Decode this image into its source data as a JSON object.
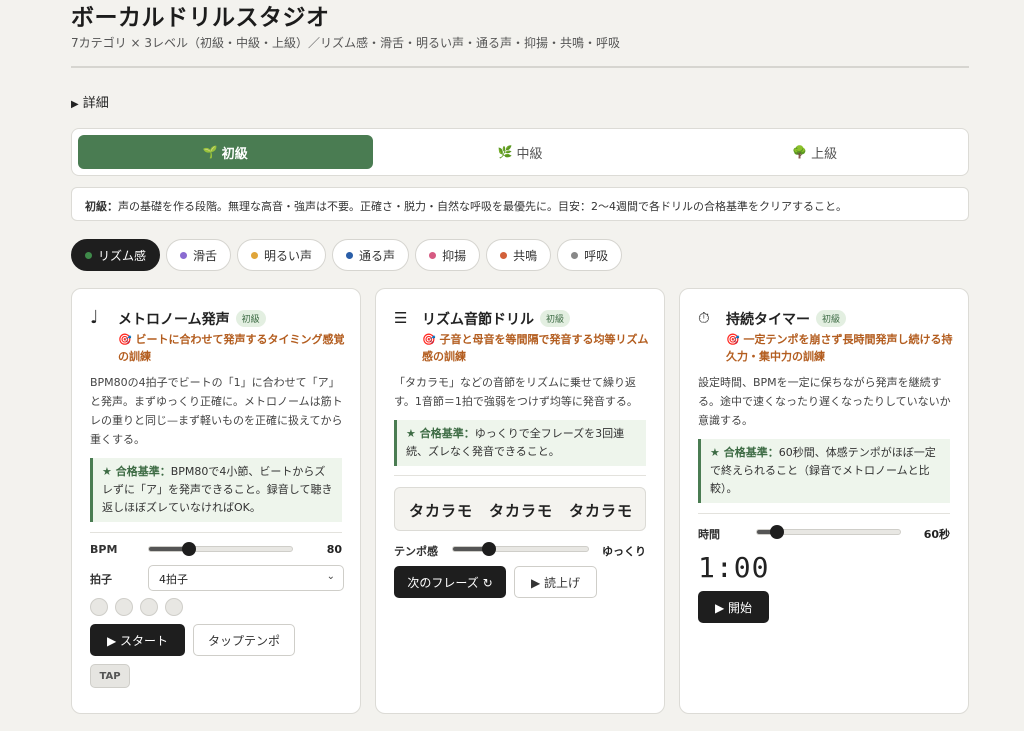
{
  "app": {
    "title": "ボーカルドリルスタジオ",
    "subtitle": "7カテゴリ × 3レベル（初級・中級・上級）／リズム感・滑舌・明るい声・通る声・抑揚・共鳴・呼吸",
    "details_label": "詳細"
  },
  "levels": [
    {
      "icon": "🌱",
      "label": "初級",
      "active": true
    },
    {
      "icon": "🌿",
      "label": "中級",
      "active": false
    },
    {
      "icon": "🌳",
      "label": "上級",
      "active": false
    }
  ],
  "level_desc": {
    "name": "初級：",
    "text": "声の基礎を作る段階。無理な高音・強声は不要。正確さ・脱力・自然な呼吸を最優先に。目安：2〜4週間で各ドリルの合格基準をクリアすること。"
  },
  "categories": [
    {
      "label": "リズム感",
      "color": "#3f8a4a",
      "active": true
    },
    {
      "label": "滑舌",
      "color": "#8a6bd1",
      "active": false
    },
    {
      "label": "明るい声",
      "color": "#e0a53a",
      "active": false
    },
    {
      "label": "通る声",
      "color": "#2a5ea8",
      "active": false
    },
    {
      "label": "抑揚",
      "color": "#d65a82",
      "active": false
    },
    {
      "label": "共鳴",
      "color": "#d2603a",
      "active": false
    },
    {
      "label": "呼吸",
      "color": "#888888",
      "active": false
    }
  ],
  "cards": {
    "metronome": {
      "icon": "♩",
      "title": "メトロノーム発声",
      "badge": "初級",
      "goal": "🎯 ビートに合わせて発声するタイミング感覚の訓練",
      "desc": "BPM80の4拍子でビートの「1」に合わせて「ア」と発声。まずゆっくり正確に。メトロノームは筋トレの重りと同じ—まず軽いものを正確に扱えてから重くする。",
      "criteria_label": "★ 合格基準：",
      "criteria": "BPM80で4小節、ビートからズレずに「ア」を発声できること。録音して聴き返しほぼズレていなければOK。",
      "bpm_label": "BPM",
      "bpm_value": "80",
      "bpm_fraction": 0.28,
      "beat_label": "拍子",
      "beat_select": "4拍子",
      "start_label": "▶ スタート",
      "tap_tempo_label": "タップテンポ",
      "tap_label": "TAP"
    },
    "rhythm": {
      "icon": "☰",
      "title": "リズム音節ドリル",
      "badge": "初級",
      "goal": "🎯 子音と母音を等間隔で発音する均等リズム感の訓練",
      "desc": "「タカラモ」などの音節をリズムに乗せて繰り返す。1音節＝1拍で強弱をつけず均等に発音する。",
      "criteria_label": "★ 合格基準：",
      "criteria": "ゆっくりで全フレーズを3回連続、ズレなく発音できること。",
      "phrase": "タカラモ　タカラモ　タカラモ",
      "tempo_label": "テンポ感",
      "tempo_value": "ゆっくり",
      "tempo_fraction": 0.27,
      "next_label": "次のフレーズ ↻",
      "read_label": "▶ 読上げ"
    },
    "timer": {
      "icon": "⏱",
      "title": "持続タイマー",
      "badge": "初級",
      "goal": "🎯 一定テンポを崩さず長時間発声し続ける持久力・集中力の訓練",
      "desc": "設定時間、BPMを一定に保ちながら発声を継続する。途中で速くなったり遅くなったりしていないか意識する。",
      "criteria_label": "★ 合格基準：",
      "criteria": "60秒間、体感テンポがほぼ一定で終えられること（録音でメトロノームと比較）。",
      "time_label": "時間",
      "time_value": "60秒",
      "time_fraction": 0.14,
      "display": "1:00",
      "start_label": "▶ 開始"
    }
  }
}
